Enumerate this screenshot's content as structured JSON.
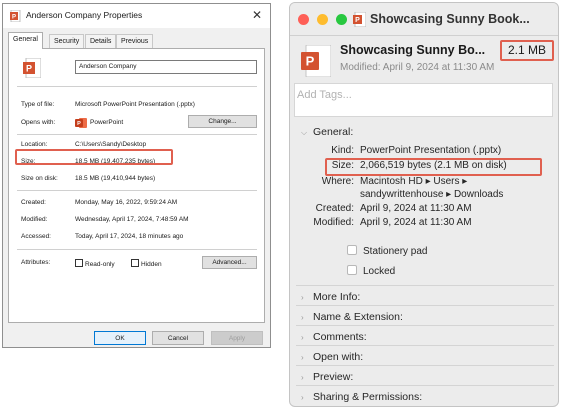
{
  "windows_dialog": {
    "title": "Anderson Company Properties",
    "close_glyph": "✕",
    "tabs": [
      "General",
      "Security",
      "Details",
      "Previous Versions"
    ],
    "file_name": "Anderson Company",
    "type_label": "Type of file:",
    "type_value": "Microsoft PowerPoint Presentation (.pptx)",
    "opens_label": "Opens with:",
    "opens_value": "PowerPoint",
    "change_button": "Change...",
    "location_label": "Location:",
    "location_value": "C:\\Users\\Sandy\\Desktop",
    "size_label": "Size:",
    "size_value": "18.5 MB (19,407,235 bytes)",
    "size_on_disk_label": "Size on disk:",
    "size_on_disk_value": "18.5 MB (19,410,944 bytes)",
    "created_label": "Created:",
    "created_value": "Monday, May 16, 2022, 9:59:24 AM",
    "modified_label": "Modified:",
    "modified_value": "Wednesday, April 17, 2024, 7:48:59 AM",
    "accessed_label": "Accessed:",
    "accessed_value": "Today, April 17, 2024, 18 minutes ago",
    "attributes_label": "Attributes:",
    "readonly_label": "Read-only",
    "hidden_label": "Hidden",
    "advanced_button": "Advanced...",
    "ok_button": "OK",
    "cancel_button": "Cancel",
    "apply_button": "Apply",
    "icon_letter": "P"
  },
  "mac_info": {
    "title": "Showcasing Sunny Book...",
    "name": "Showcasing Sunny Bo...",
    "size_badge": "2.1 MB",
    "modified": "Modified: April 9, 2024 at 11:30 AM",
    "tags_placeholder": "Add Tags...",
    "general_header": "General:",
    "kind_label": "Kind:",
    "kind_value": "PowerPoint Presentation (.pptx)",
    "size_label": "Size:",
    "size_value": "2,066,519 bytes (2.1 MB on disk)",
    "where_label": "Where:",
    "where_value_line1": "Macintosh HD ▸ Users ▸",
    "where_value_line2": "sandywrittenhouse ▸ Downloads",
    "created_label": "Created:",
    "created_value": "April 9, 2024 at 11:30 AM",
    "modified_label": "Modified:",
    "modified_value": "April 9, 2024 at 11:30 AM",
    "stationery_label": "Stationery pad",
    "locked_label": "Locked",
    "sections": [
      "More Info:",
      "Name & Extension:",
      "Comments:",
      "Open with:",
      "Preview:",
      "Sharing & Permissions:"
    ],
    "icon_letter": "P"
  },
  "colors": {
    "highlight": "#e0604f",
    "powerpoint": "#d35230"
  }
}
